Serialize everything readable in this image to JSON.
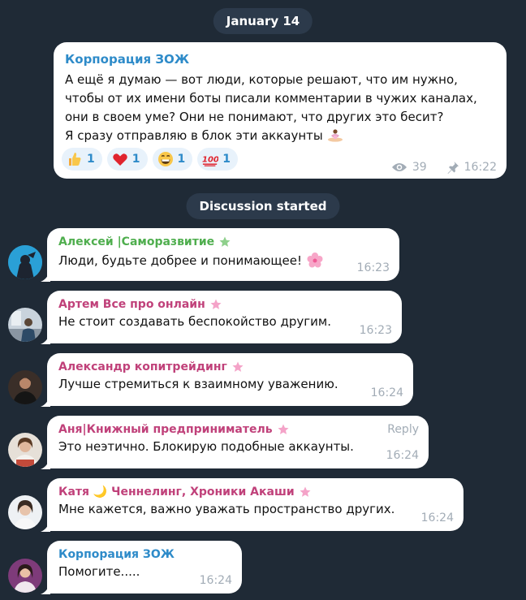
{
  "date_pill": "January 14",
  "discussion_pill": "Discussion started",
  "channel_post": {
    "author": "Корпорация ЗОЖ",
    "text": "А ещё я думаю — вот люди, которые решают, что им нужно,\nчтобы от их имени боты писали комментарии в чужих каналах,\nони в своем уме? Они не понимают, что других это бесит?\nЯ сразу отправляю в блок эти аккаунты",
    "reactions": [
      {
        "emoji": "thumbs-up",
        "count": "1"
      },
      {
        "emoji": "red-heart",
        "count": "1"
      },
      {
        "emoji": "grinning-face",
        "count": "1"
      },
      {
        "emoji": "hundred-points",
        "count": "1"
      }
    ],
    "views": "39",
    "time": "16:22"
  },
  "comments": [
    {
      "author": "Алексей |Саморазвитие",
      "author_color": "#4fae4e",
      "text": "Люди, будьте добрее и понимающее!",
      "time": "16:23",
      "reply": ""
    },
    {
      "author": "Артем Все про онлайн",
      "author_color": "#c0417a",
      "text": "Не стоит создавать беспокойство другим.",
      "time": "16:23",
      "reply": ""
    },
    {
      "author": "Александр копитрейдинг",
      "author_color": "#c0417a",
      "text": "Лучше стремиться к взаимному уважению.",
      "time": "16:24",
      "reply": ""
    },
    {
      "author": "Аня|Книжный предприниматель",
      "author_color": "#c0417a",
      "text": "Это неэтично. Блокирую подобные аккаунты.",
      "time": "16:24",
      "reply": "Reply"
    },
    {
      "author": "Катя 🌙 Ченнелинг, Хроники Акаши",
      "author_color": "#c0417a",
      "text": "Мне кажется, важно уважать пространство других.",
      "time": "16:24",
      "reply": ""
    },
    {
      "author": "Корпорация ЗОЖ",
      "author_color": "#2e8bc9",
      "text": "Помогите.....",
      "time": "16:24",
      "reply": ""
    }
  ]
}
